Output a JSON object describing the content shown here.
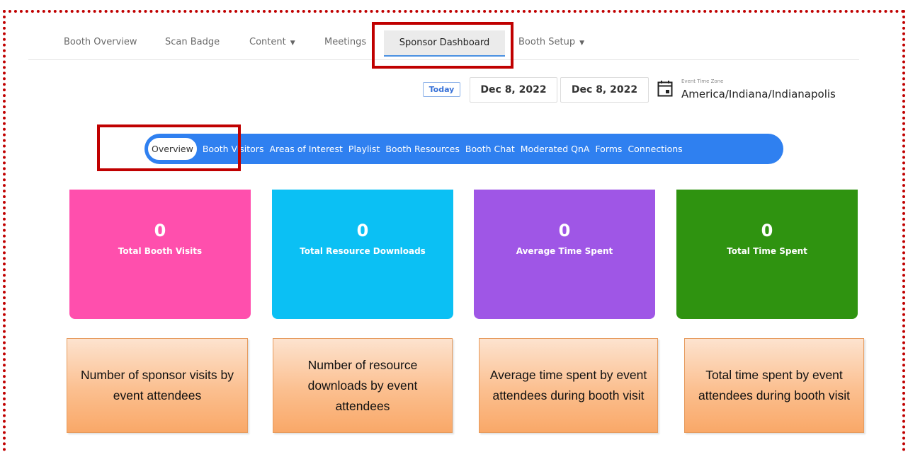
{
  "topnav": {
    "items": [
      {
        "label": "Booth Overview"
      },
      {
        "label": "Scan Badge"
      },
      {
        "label": "Content",
        "dropdown": true
      },
      {
        "label": "Meetings"
      },
      {
        "label": "Booth Setup",
        "dropdown": true
      }
    ],
    "active_label": "Sponsor Dashboard",
    "caret": "▼"
  },
  "dates": {
    "today_label": "Today",
    "start": "Dec 8, 2022",
    "end": "Dec 8, 2022",
    "tz_label": "Event Time Zone",
    "tz_value": "America/Indiana/Indianapolis"
  },
  "tabs": [
    {
      "label": "Overview",
      "active": true
    },
    {
      "label": "Booth Visitors"
    },
    {
      "label": "Areas of Interest"
    },
    {
      "label": "Playlist"
    },
    {
      "label": "Booth Resources"
    },
    {
      "label": "Booth Chat"
    },
    {
      "label": "Moderated QnA"
    },
    {
      "label": "Forms"
    },
    {
      "label": "Connections"
    }
  ],
  "cards": [
    {
      "value": "0",
      "label": "Total Booth Visits",
      "color": "#ff4fad"
    },
    {
      "value": "0",
      "label": "Total Resource Downloads",
      "color": "#0bc0f4"
    },
    {
      "value": "0",
      "label": "Average Time Spent",
      "color": "#9f56e6"
    },
    {
      "value": "0",
      "label": "Total Time Spent",
      "color": "#2f9310"
    }
  ],
  "callouts": [
    {
      "text": "Number of sponsor visits by event attendees"
    },
    {
      "text": "Number of resource downloads by event attendees"
    },
    {
      "text": "Average time spent by event attendees during booth visit"
    },
    {
      "text": "Total time spent by event attendees during booth visit"
    }
  ],
  "colors": {
    "highlight": "#c00000",
    "accent": "#2f80f0"
  }
}
